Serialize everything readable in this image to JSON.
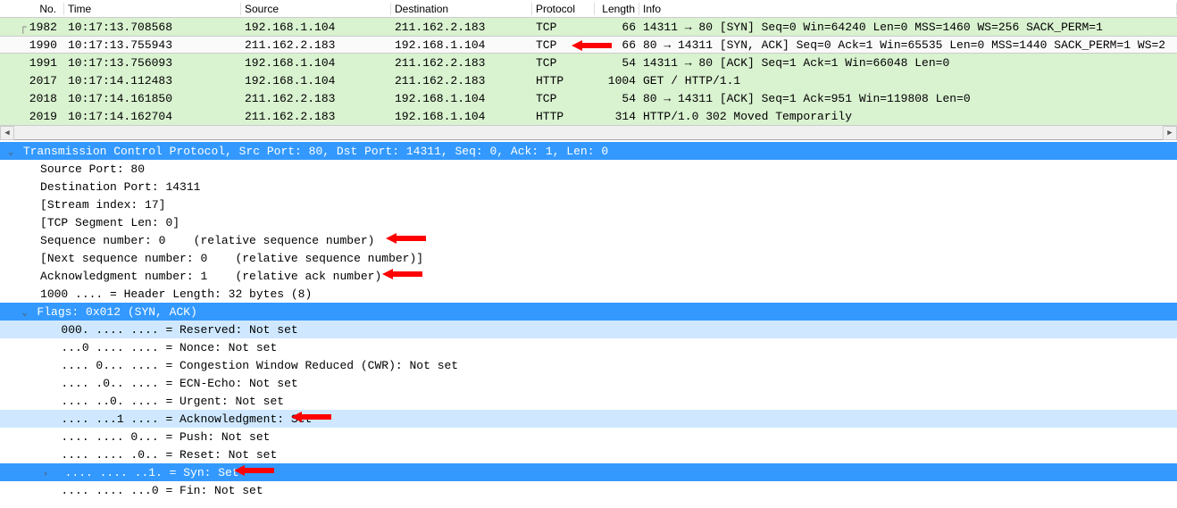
{
  "columns": {
    "no": "No.",
    "time": "Time",
    "source": "Source",
    "destination": "Destination",
    "protocol": "Protocol",
    "length": "Length",
    "info": "Info"
  },
  "packets": [
    {
      "no": "1982",
      "time": "10:17:13.708568",
      "src": "192.168.1.104",
      "dst": "211.162.2.183",
      "proto": "TCP",
      "len": "66",
      "info": "14311 → 80 [SYN] Seq=0 Win=64240 Len=0 MSS=1460 WS=256 SACK_PERM=1",
      "cls": "bg-syn"
    },
    {
      "no": "1990",
      "time": "10:17:13.755943",
      "src": "211.162.2.183",
      "dst": "192.168.1.104",
      "proto": "TCP",
      "len": "66",
      "info": "80 → 14311 [SYN, ACK] Seq=0 Ack=1 Win=65535 Len=0 MSS=1440 SACK_PERM=1 WS=2",
      "cls": "bg-sel"
    },
    {
      "no": "1991",
      "time": "10:17:13.756093",
      "src": "192.168.1.104",
      "dst": "211.162.2.183",
      "proto": "TCP",
      "len": "54",
      "info": "14311 → 80 [ACK] Seq=1 Ack=1 Win=66048 Len=0",
      "cls": "bg-syn"
    },
    {
      "no": "2017",
      "time": "10:17:14.112483",
      "src": "192.168.1.104",
      "dst": "211.162.2.183",
      "proto": "HTTP",
      "len": "1004",
      "info": "GET / HTTP/1.1",
      "cls": "bg-http"
    },
    {
      "no": "2018",
      "time": "10:17:14.161850",
      "src": "211.162.2.183",
      "dst": "192.168.1.104",
      "proto": "TCP",
      "len": "54",
      "info": "80 → 14311 [ACK] Seq=1 Ack=951 Win=119808 Len=0",
      "cls": "bg-syn"
    },
    {
      "no": "2019",
      "time": "10:17:14.162704",
      "src": "211.162.2.183",
      "dst": "192.168.1.104",
      "proto": "HTTP",
      "len": "314",
      "info": "HTTP/1.0 302 Moved Temporarily",
      "cls": "bg-http"
    }
  ],
  "details": {
    "tcp_header": "Transmission Control Protocol, Src Port: 80, Dst Port: 14311, Seq: 0, Ack: 1, Len: 0",
    "src_port": "Source Port: 80",
    "dst_port": "Destination Port: 14311",
    "stream": "[Stream index: 17]",
    "seglen": "[TCP Segment Len: 0]",
    "seqnum": "Sequence number: 0    (relative sequence number)",
    "nextseq": "[Next sequence number: 0    (relative sequence number)]",
    "acknum": "Acknowledgment number: 1    (relative ack number)",
    "hdrlen": "1000 .... = Header Length: 32 bytes (8)",
    "flags_hdr": "Flags: 0x012 (SYN, ACK)",
    "f_resv": "000. .... .... = Reserved: Not set",
    "f_nonce": "...0 .... .... = Nonce: Not set",
    "f_cwr": ".... 0... .... = Congestion Window Reduced (CWR): Not set",
    "f_ecn": ".... .0.. .... = ECN-Echo: Not set",
    "f_urg": ".... ..0. .... = Urgent: Not set",
    "f_ack": ".... ...1 .... = Acknowledgment: Set",
    "f_psh": ".... .... 0... = Push: Not set",
    "f_rst": ".... .... .0.. = Reset: Not set",
    "f_syn": ".... .... ..1. = Syn: Set",
    "f_fin": ".... .... ...0 = Fin: Not set"
  }
}
